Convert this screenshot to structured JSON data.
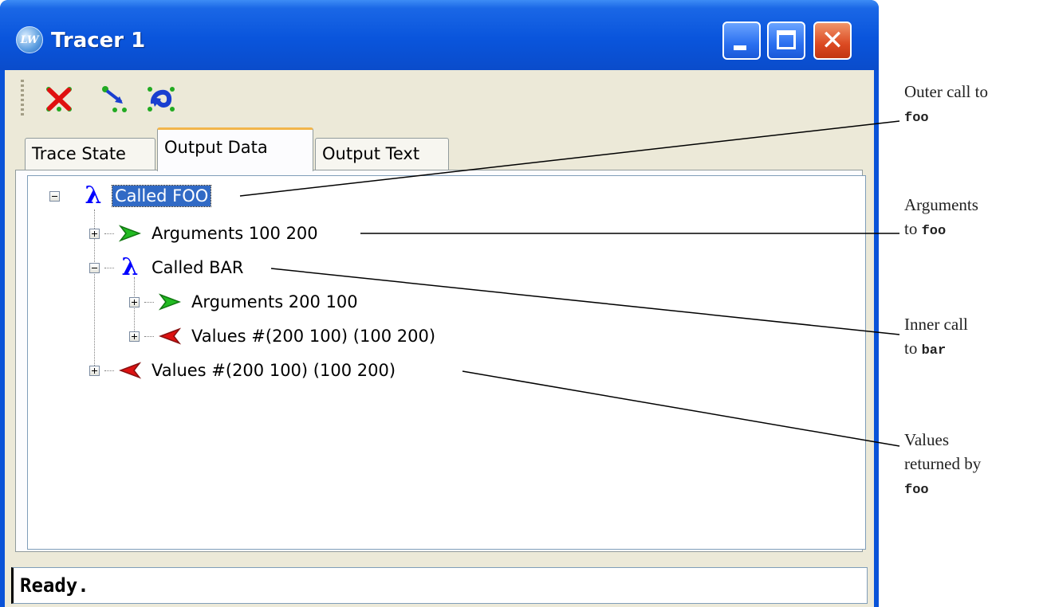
{
  "window": {
    "title": "Tracer 1",
    "app_icon": "LW",
    "controls": [
      "minimize-icon",
      "maximize-icon",
      "close-icon"
    ]
  },
  "toolbar": {
    "buttons": [
      {
        "icon": "clear-trace-icon"
      },
      {
        "icon": "trace-step-icon"
      },
      {
        "icon": "retrace-icon"
      }
    ]
  },
  "tabs": [
    {
      "label": "Trace State",
      "selected": false
    },
    {
      "label": "Output Data",
      "selected": true
    },
    {
      "label": "Output Text",
      "selected": false
    }
  ],
  "tree": [
    {
      "label": "Called FOO",
      "icon": "lambda-icon",
      "expanded": true,
      "selected": true
    },
    {
      "label": "Arguments 100 200",
      "icon": "arguments-arrow-icon",
      "expanded": false
    },
    {
      "label": "Called BAR",
      "icon": "lambda-icon",
      "expanded": true
    },
    {
      "label": "Arguments 200 100",
      "icon": "arguments-arrow-icon",
      "expanded": false
    },
    {
      "label": "Values #(200 100) (100 200)",
      "icon": "values-arrow-icon",
      "expanded": false
    },
    {
      "label": "Values #(200 100) (100 200)",
      "icon": "values-arrow-icon",
      "expanded": false
    }
  ],
  "status": "Ready.",
  "annotations": [
    {
      "text": "Outer call to",
      "code": "foo"
    },
    {
      "text": "Arguments",
      "text2": "to",
      "code": "foo"
    },
    {
      "text": "Inner call",
      "text2": "to",
      "code": "bar"
    },
    {
      "text": "Values",
      "text2": "returned by",
      "code": "foo"
    }
  ],
  "colors": {
    "titlebar": "#0a55dc",
    "selection": "#316ac5",
    "lambda": "#0000ff",
    "arguments_arrow": "#22bb22",
    "values_arrow": "#dd1111",
    "active_tab_accent": "#f2b54a"
  }
}
